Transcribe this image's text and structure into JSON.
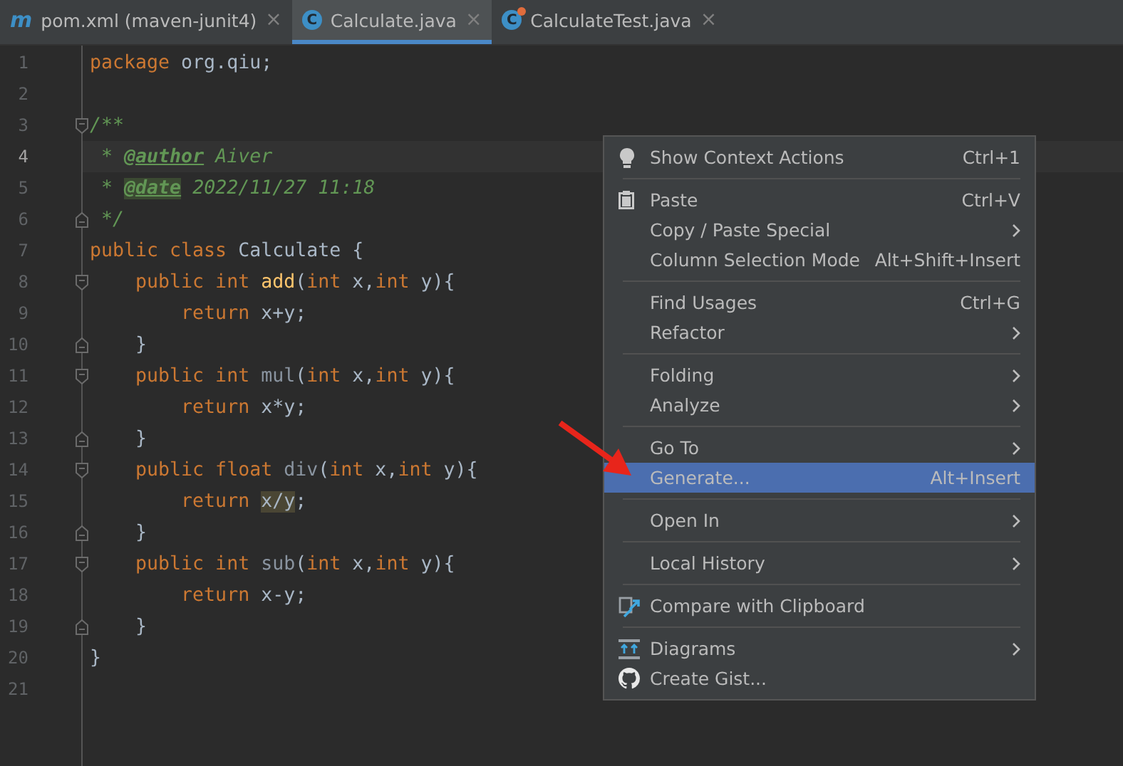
{
  "tabs": [
    {
      "kind": "maven",
      "icon_text": "m",
      "label": "pom.xml (maven-junit4)",
      "close": "×",
      "selected": false
    },
    {
      "kind": "class",
      "icon_text": "C",
      "label": "Calculate.java",
      "close": "×",
      "selected": true
    },
    {
      "kind": "test-class",
      "icon_text": "C",
      "label": "CalculateTest.java",
      "close": "×",
      "selected": false
    }
  ],
  "editor": {
    "lines": [
      {
        "number": "1",
        "current": false,
        "tokens": [
          {
            "kind": "kw",
            "text": "package "
          },
          {
            "kind": "plain",
            "text": "org.qiu;"
          }
        ]
      },
      {
        "number": "2",
        "current": false
      },
      {
        "number": "3",
        "current": false,
        "kind": "fold-open",
        "tokens": [
          {
            "kind": "doc",
            "text": "/**"
          }
        ]
      },
      {
        "number": "4",
        "current": true,
        "tokens": [
          {
            "kind": "doc",
            "text": " * "
          },
          {
            "kind": "doctag",
            "text": "@author"
          },
          {
            "kind": "doc",
            "text": " Aiver"
          }
        ]
      },
      {
        "number": "5",
        "current": false,
        "tokens": [
          {
            "kind": "doc",
            "text": " * "
          },
          {
            "kind": "doctag-hl",
            "text": "@date"
          },
          {
            "kind": "doc",
            "text": " 2022/11/27 11:18"
          }
        ]
      },
      {
        "number": "6",
        "current": false,
        "kind": "fold-close",
        "tokens": [
          {
            "kind": "doc",
            "text": " */"
          }
        ]
      },
      {
        "number": "7",
        "current": false,
        "tokens": [
          {
            "kind": "kw",
            "text": "public class "
          },
          {
            "kind": "plain",
            "text": "Calculate {"
          }
        ]
      },
      {
        "number": "8",
        "current": false,
        "kind": "fold-open",
        "tokens": [
          {
            "kind": "kw",
            "text": "    public int "
          },
          {
            "kind": "fn",
            "text": "add"
          },
          {
            "kind": "plain",
            "text": "("
          },
          {
            "kind": "kw",
            "text": "int "
          },
          {
            "kind": "plain",
            "text": "x,"
          },
          {
            "kind": "kw",
            "text": "int "
          },
          {
            "kind": "plain",
            "text": "y){"
          }
        ]
      },
      {
        "number": "9",
        "current": false,
        "tokens": [
          {
            "kind": "kw",
            "text": "        return "
          },
          {
            "kind": "plain",
            "text": "x+y;"
          }
        ]
      },
      {
        "number": "10",
        "current": false,
        "kind": "fold-close",
        "tokens": [
          {
            "kind": "plain",
            "text": "    }"
          }
        ]
      },
      {
        "number": "11",
        "current": false,
        "kind": "fold-open",
        "tokens": [
          {
            "kind": "kw",
            "text": "    public int "
          },
          {
            "kind": "fn-unused",
            "text": "mul"
          },
          {
            "kind": "plain",
            "text": "("
          },
          {
            "kind": "kw",
            "text": "int "
          },
          {
            "kind": "plain",
            "text": "x,"
          },
          {
            "kind": "kw",
            "text": "int "
          },
          {
            "kind": "plain",
            "text": "y){"
          }
        ]
      },
      {
        "number": "12",
        "current": false,
        "tokens": [
          {
            "kind": "kw",
            "text": "        return "
          },
          {
            "kind": "plain",
            "text": "x*y;"
          }
        ]
      },
      {
        "number": "13",
        "current": false,
        "kind": "fold-close",
        "tokens": [
          {
            "kind": "plain",
            "text": "    }"
          }
        ]
      },
      {
        "number": "14",
        "current": false,
        "kind": "fold-open",
        "tokens": [
          {
            "kind": "kw",
            "text": "    public float "
          },
          {
            "kind": "fn-unused",
            "text": "div"
          },
          {
            "kind": "plain",
            "text": "("
          },
          {
            "kind": "kw",
            "text": "int "
          },
          {
            "kind": "plain",
            "text": "x,"
          },
          {
            "kind": "kw",
            "text": "int "
          },
          {
            "kind": "plain",
            "text": "y){"
          }
        ]
      },
      {
        "number": "15",
        "current": false,
        "tokens": [
          {
            "kind": "kw",
            "text": "        return "
          },
          {
            "kind": "hl",
            "text": "x/y"
          },
          {
            "kind": "plain",
            "text": ";"
          }
        ]
      },
      {
        "number": "16",
        "current": false,
        "kind": "fold-close",
        "tokens": [
          {
            "kind": "plain",
            "text": "    }"
          }
        ]
      },
      {
        "number": "17",
        "current": false,
        "kind": "fold-open",
        "tokens": [
          {
            "kind": "kw",
            "text": "    public int "
          },
          {
            "kind": "fn-unused",
            "text": "sub"
          },
          {
            "kind": "plain",
            "text": "("
          },
          {
            "kind": "kw",
            "text": "int "
          },
          {
            "kind": "plain",
            "text": "x,"
          },
          {
            "kind": "kw",
            "text": "int "
          },
          {
            "kind": "plain",
            "text": "y){"
          }
        ]
      },
      {
        "number": "18",
        "current": false,
        "tokens": [
          {
            "kind": "kw",
            "text": "        return "
          },
          {
            "kind": "plain",
            "text": "x-y;"
          }
        ]
      },
      {
        "number": "19",
        "current": false,
        "kind": "fold-close",
        "tokens": [
          {
            "kind": "plain",
            "text": "    }"
          }
        ]
      },
      {
        "number": "20",
        "current": false,
        "tokens": [
          {
            "kind": "plain",
            "text": "}"
          }
        ]
      },
      {
        "number": "21",
        "current": false
      }
    ]
  },
  "context_menu": {
    "groups": [
      [
        {
          "kind": "bulb",
          "label": "Show Context Actions",
          "shortcut": "Ctrl+1",
          "submenu": false,
          "selected": false
        }
      ],
      [
        {
          "kind": "clipboard",
          "label": "Paste",
          "shortcut": "Ctrl+V",
          "submenu": false,
          "selected": false
        },
        {
          "label": "Copy / Paste Special",
          "submenu": true,
          "selected": false
        },
        {
          "label": "Column Selection Mode",
          "shortcut": "Alt+Shift+Insert",
          "submenu": false,
          "selected": false
        }
      ],
      [
        {
          "label": "Find Usages",
          "shortcut": "Ctrl+G",
          "submenu": false,
          "selected": false
        },
        {
          "label": "Refactor",
          "submenu": true,
          "selected": false
        }
      ],
      [
        {
          "label": "Folding",
          "submenu": true,
          "selected": false
        },
        {
          "label": "Analyze",
          "submenu": true,
          "selected": false
        }
      ],
      [
        {
          "label": "Go To",
          "submenu": true,
          "selected": false
        },
        {
          "label": "Generate...",
          "shortcut": "Alt+Insert",
          "submenu": false,
          "selected": true
        }
      ],
      [
        {
          "label": "Open In",
          "submenu": true,
          "selected": false
        }
      ],
      [
        {
          "label": "Local History",
          "submenu": true,
          "selected": false
        }
      ],
      [
        {
          "kind": "compare",
          "label": "Compare with Clipboard",
          "submenu": false,
          "selected": false
        }
      ],
      [
        {
          "kind": "diagrams",
          "label": "Diagrams",
          "submenu": true,
          "selected": false
        },
        {
          "kind": "github",
          "label": "Create Gist...",
          "submenu": false,
          "selected": false
        }
      ]
    ]
  }
}
